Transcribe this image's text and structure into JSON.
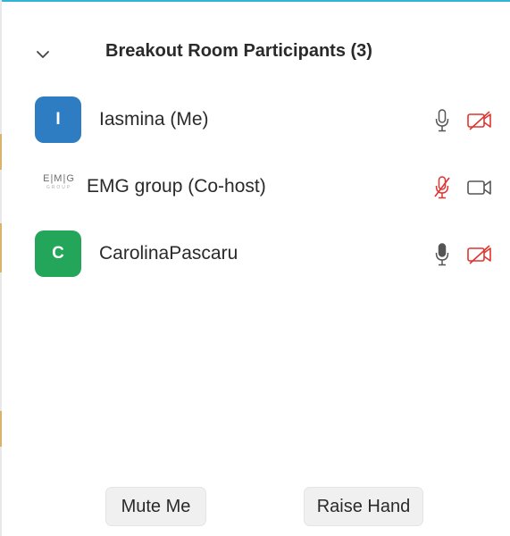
{
  "header": {
    "title": "Breakout Room Participants (3)",
    "collapse_icon": "chevron-down-icon"
  },
  "participants": [
    {
      "name": "Iasmina (Me)",
      "avatar_type": "initial",
      "avatar_text": "I",
      "avatar_color": "#2e7cc1",
      "mic": "on",
      "mic_icon": "microphone-outline-icon",
      "video": "off",
      "video_icon": "video-off-icon"
    },
    {
      "name": "EMG group (Co-host)",
      "avatar_type": "logo",
      "logo_text": "E|M|G",
      "logo_subtext": "GROUP",
      "mic": "muted",
      "mic_icon": "microphone-muted-icon",
      "video": "on",
      "video_icon": "video-camera-icon"
    },
    {
      "name": "CarolinaPascaru",
      "avatar_type": "initial",
      "avatar_text": "C",
      "avatar_color": "#23a55a",
      "mic": "on",
      "mic_icon": "microphone-filled-icon",
      "video": "off",
      "video_icon": "video-off-icon"
    }
  ],
  "actions": {
    "mute_me_label": "Mute Me",
    "raise_hand_label": "Raise Hand"
  },
  "colors": {
    "accent": "#34b4d4",
    "muted_red": "#e0342f",
    "icon_gray": "#555555",
    "button_bg": "#f0f0f0"
  }
}
